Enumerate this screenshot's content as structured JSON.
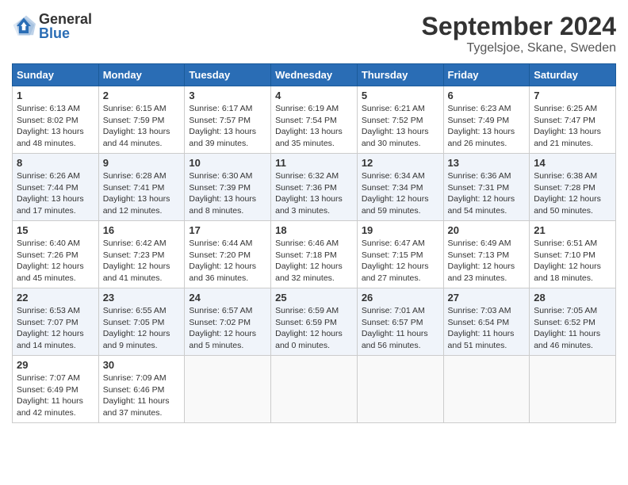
{
  "header": {
    "logo_general": "General",
    "logo_blue": "Blue",
    "month_year": "September 2024",
    "location": "Tygelsjoe, Skane, Sweden"
  },
  "weekdays": [
    "Sunday",
    "Monday",
    "Tuesday",
    "Wednesday",
    "Thursday",
    "Friday",
    "Saturday"
  ],
  "weeks": [
    [
      {
        "day": "1",
        "sunrise": "6:13 AM",
        "sunset": "8:02 PM",
        "daylight": "13 hours and 48 minutes."
      },
      {
        "day": "2",
        "sunrise": "6:15 AM",
        "sunset": "7:59 PM",
        "daylight": "13 hours and 44 minutes."
      },
      {
        "day": "3",
        "sunrise": "6:17 AM",
        "sunset": "7:57 PM",
        "daylight": "13 hours and 39 minutes."
      },
      {
        "day": "4",
        "sunrise": "6:19 AM",
        "sunset": "7:54 PM",
        "daylight": "13 hours and 35 minutes."
      },
      {
        "day": "5",
        "sunrise": "6:21 AM",
        "sunset": "7:52 PM",
        "daylight": "13 hours and 30 minutes."
      },
      {
        "day": "6",
        "sunrise": "6:23 AM",
        "sunset": "7:49 PM",
        "daylight": "13 hours and 26 minutes."
      },
      {
        "day": "7",
        "sunrise": "6:25 AM",
        "sunset": "7:47 PM",
        "daylight": "13 hours and 21 minutes."
      }
    ],
    [
      {
        "day": "8",
        "sunrise": "6:26 AM",
        "sunset": "7:44 PM",
        "daylight": "13 hours and 17 minutes."
      },
      {
        "day": "9",
        "sunrise": "6:28 AM",
        "sunset": "7:41 PM",
        "daylight": "13 hours and 12 minutes."
      },
      {
        "day": "10",
        "sunrise": "6:30 AM",
        "sunset": "7:39 PM",
        "daylight": "13 hours and 8 minutes."
      },
      {
        "day": "11",
        "sunrise": "6:32 AM",
        "sunset": "7:36 PM",
        "daylight": "13 hours and 3 minutes."
      },
      {
        "day": "12",
        "sunrise": "6:34 AM",
        "sunset": "7:34 PM",
        "daylight": "12 hours and 59 minutes."
      },
      {
        "day": "13",
        "sunrise": "6:36 AM",
        "sunset": "7:31 PM",
        "daylight": "12 hours and 54 minutes."
      },
      {
        "day": "14",
        "sunrise": "6:38 AM",
        "sunset": "7:28 PM",
        "daylight": "12 hours and 50 minutes."
      }
    ],
    [
      {
        "day": "15",
        "sunrise": "6:40 AM",
        "sunset": "7:26 PM",
        "daylight": "12 hours and 45 minutes."
      },
      {
        "day": "16",
        "sunrise": "6:42 AM",
        "sunset": "7:23 PM",
        "daylight": "12 hours and 41 minutes."
      },
      {
        "day": "17",
        "sunrise": "6:44 AM",
        "sunset": "7:20 PM",
        "daylight": "12 hours and 36 minutes."
      },
      {
        "day": "18",
        "sunrise": "6:46 AM",
        "sunset": "7:18 PM",
        "daylight": "12 hours and 32 minutes."
      },
      {
        "day": "19",
        "sunrise": "6:47 AM",
        "sunset": "7:15 PM",
        "daylight": "12 hours and 27 minutes."
      },
      {
        "day": "20",
        "sunrise": "6:49 AM",
        "sunset": "7:13 PM",
        "daylight": "12 hours and 23 minutes."
      },
      {
        "day": "21",
        "sunrise": "6:51 AM",
        "sunset": "7:10 PM",
        "daylight": "12 hours and 18 minutes."
      }
    ],
    [
      {
        "day": "22",
        "sunrise": "6:53 AM",
        "sunset": "7:07 PM",
        "daylight": "12 hours and 14 minutes."
      },
      {
        "day": "23",
        "sunrise": "6:55 AM",
        "sunset": "7:05 PM",
        "daylight": "12 hours and 9 minutes."
      },
      {
        "day": "24",
        "sunrise": "6:57 AM",
        "sunset": "7:02 PM",
        "daylight": "12 hours and 5 minutes."
      },
      {
        "day": "25",
        "sunrise": "6:59 AM",
        "sunset": "6:59 PM",
        "daylight": "12 hours and 0 minutes."
      },
      {
        "day": "26",
        "sunrise": "7:01 AM",
        "sunset": "6:57 PM",
        "daylight": "11 hours and 56 minutes."
      },
      {
        "day": "27",
        "sunrise": "7:03 AM",
        "sunset": "6:54 PM",
        "daylight": "11 hours and 51 minutes."
      },
      {
        "day": "28",
        "sunrise": "7:05 AM",
        "sunset": "6:52 PM",
        "daylight": "11 hours and 46 minutes."
      }
    ],
    [
      {
        "day": "29",
        "sunrise": "7:07 AM",
        "sunset": "6:49 PM",
        "daylight": "11 hours and 42 minutes."
      },
      {
        "day": "30",
        "sunrise": "7:09 AM",
        "sunset": "6:46 PM",
        "daylight": "11 hours and 37 minutes."
      },
      null,
      null,
      null,
      null,
      null
    ]
  ]
}
